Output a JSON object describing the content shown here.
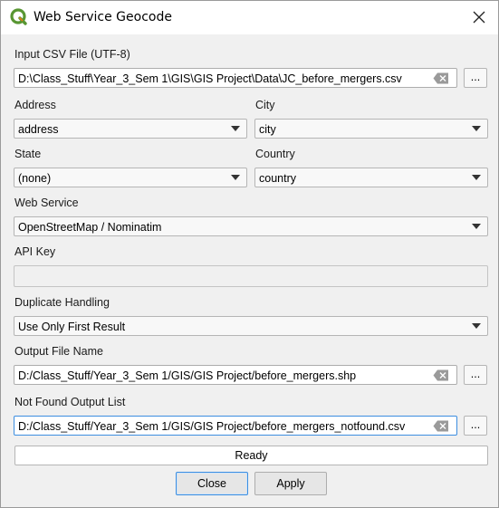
{
  "window": {
    "title": "Web Service Geocode"
  },
  "input_csv": {
    "label": "Input CSV File (UTF-8)",
    "value": "D:\\Class_Stuff\\Year_3_Sem 1\\GIS\\GIS Project\\Data\\JC_before_mergers.csv",
    "browse_label": "..."
  },
  "address": {
    "label": "Address",
    "value": "address"
  },
  "city": {
    "label": "City",
    "value": "city"
  },
  "state": {
    "label": "State",
    "value": "(none)"
  },
  "country": {
    "label": "Country",
    "value": "country"
  },
  "web_service": {
    "label": "Web Service",
    "value": "OpenStreetMap / Nominatim"
  },
  "api_key": {
    "label": "API Key",
    "value": ""
  },
  "duplicate_handling": {
    "label": "Duplicate Handling",
    "value": "Use Only First Result"
  },
  "output_file": {
    "label": "Output File Name",
    "value": "D:/Class_Stuff/Year_3_Sem 1/GIS/GIS Project/before_mergers.shp",
    "browse_label": "..."
  },
  "not_found": {
    "label": "Not Found Output List",
    "value": "D:/Class_Stuff/Year_3_Sem 1/GIS/GIS Project/before_mergers_notfound.csv",
    "browse_label": "..."
  },
  "status": {
    "text": "Ready"
  },
  "buttons": {
    "close": "Close",
    "apply": "Apply"
  },
  "colors": {
    "focus_border": "#3d8ee0",
    "qgis_green": "#589632",
    "qgis_yellow": "#ee7913"
  },
  "icons": {
    "app": "qgis-logo-icon",
    "close": "close-icon",
    "clear": "clear-text-icon",
    "dropdown": "chevron-down-icon"
  }
}
